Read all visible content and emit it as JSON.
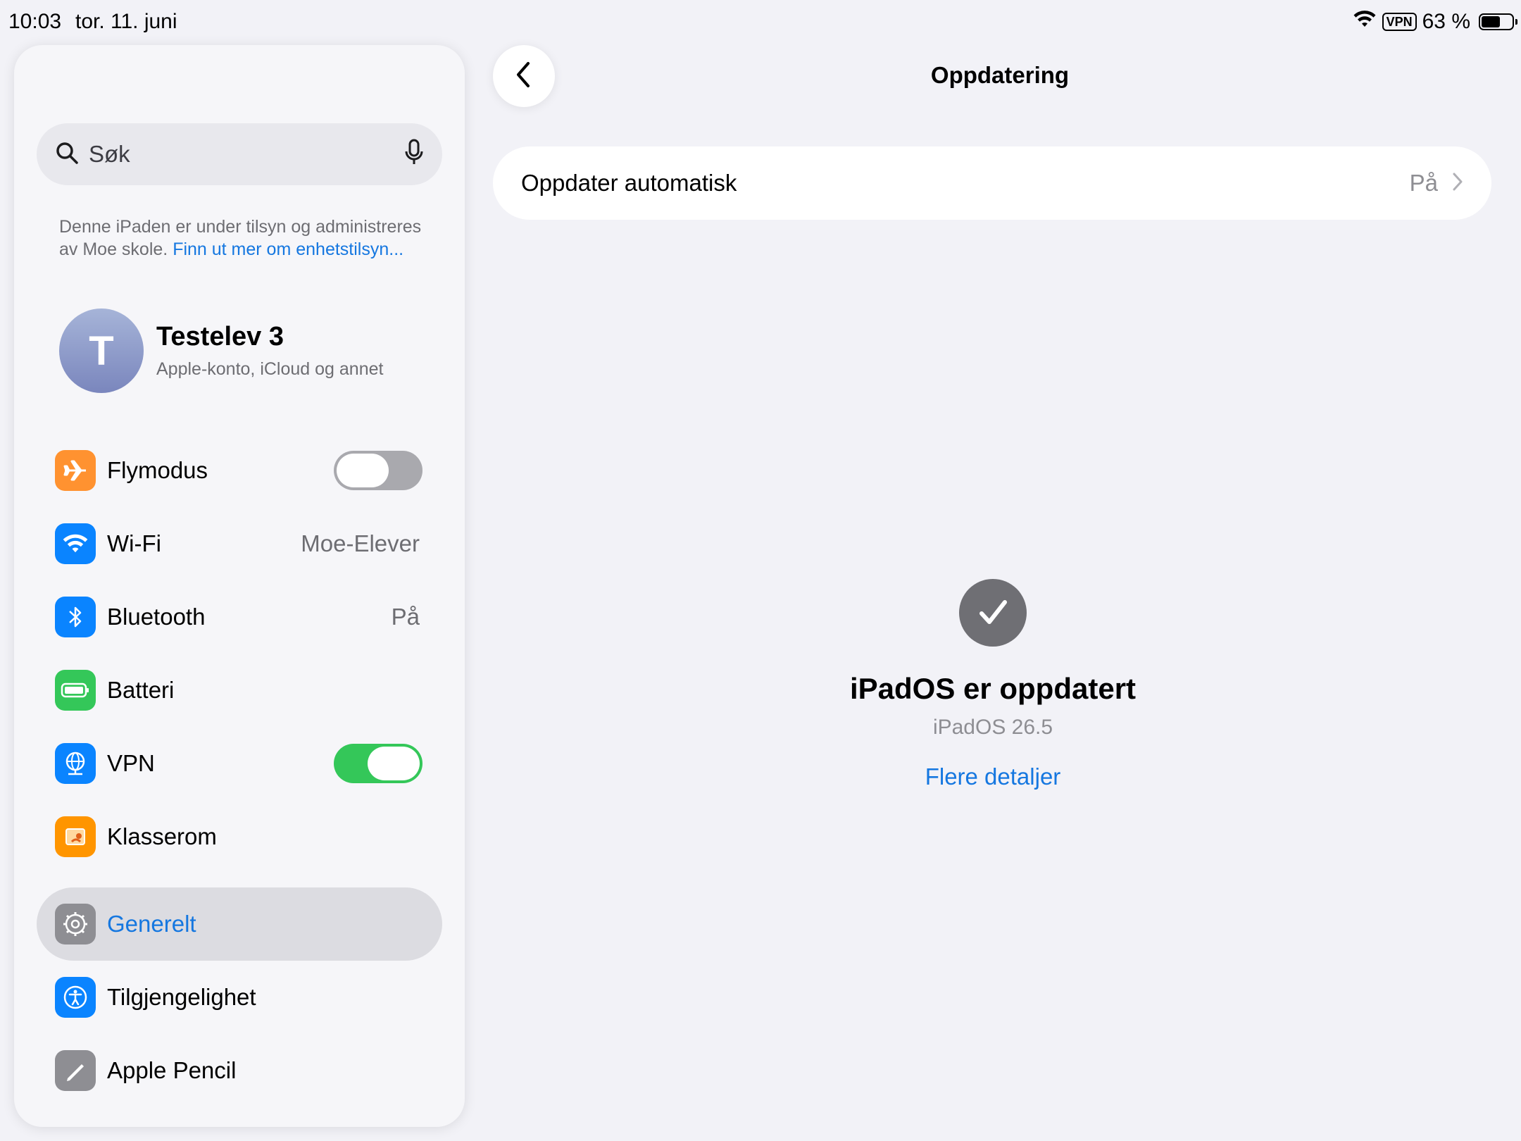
{
  "status_bar": {
    "time": "10:03",
    "date": "tor. 11. juni",
    "vpn": "VPN",
    "battery": "63 %",
    "battery_level": 0.63
  },
  "sidebar": {
    "search_placeholder": "Søk",
    "notice_text": "Denne iPaden er under tilsyn og administreres av Moe skole. ",
    "notice_link": "Finn ut mer om enhetstilsyn...",
    "profile": {
      "initial": "T",
      "name": "Testelev 3",
      "subtitle": "Apple-konto, iCloud og annet"
    },
    "items": [
      {
        "label": "Flymodus",
        "icon": "airplane-icon",
        "color": "#ff9230",
        "toggle": false
      },
      {
        "label": "Wi-Fi",
        "icon": "wifi-icon",
        "color": "#0a84ff",
        "value": "Moe-Elever"
      },
      {
        "label": "Bluetooth",
        "icon": "bluetooth-icon",
        "color": "#0a84ff",
        "value": "På"
      },
      {
        "label": "Batteri",
        "icon": "battery-icon",
        "color": "#34c759"
      },
      {
        "label": "VPN",
        "icon": "globe-icon",
        "color": "#0a84ff",
        "toggle": true
      },
      {
        "label": "Klasserom",
        "icon": "classroom-icon",
        "color": "#ff9500"
      },
      {
        "label": "Generelt",
        "icon": "gear-icon",
        "color": "#8e8e93",
        "selected": true
      },
      {
        "label": "Tilgjengelighet",
        "icon": "accessibility-icon",
        "color": "#0a84ff"
      },
      {
        "label": "Apple Pencil",
        "icon": "pencil-icon",
        "color": "#8e8e93"
      }
    ]
  },
  "detail": {
    "title": "Oppdatering",
    "auto_update_label": "Oppdater automatisk",
    "auto_update_value": "På",
    "status_title": "iPadOS er oppdatert",
    "status_version": "iPadOS 26.5",
    "more_details": "Flere detaljer"
  }
}
